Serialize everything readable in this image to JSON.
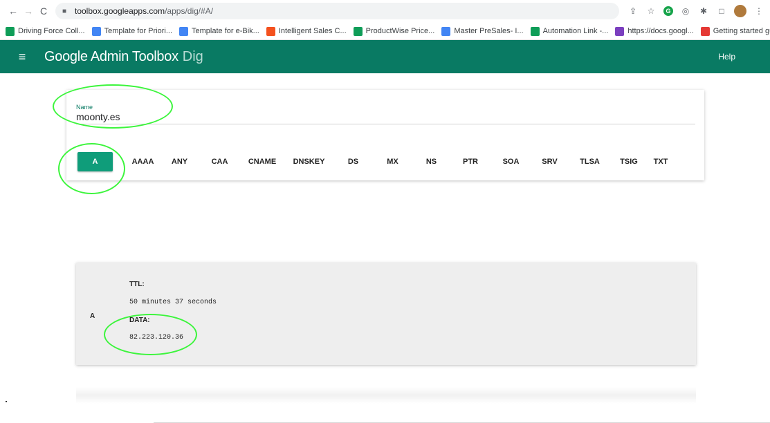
{
  "browser": {
    "url_host": "toolbox.googleapps.com",
    "url_path": "/apps/dig/#A/",
    "bookmarks": [
      {
        "label": "Driving Force Coll...",
        "color": "#0f9d58"
      },
      {
        "label": "Template for Priori...",
        "color": "#4285f4"
      },
      {
        "label": "Template for e-Bik...",
        "color": "#4285f4"
      },
      {
        "label": "Intelligent Sales C...",
        "color": "#f4511e"
      },
      {
        "label": "ProductWise Price...",
        "color": "#0f9d58"
      },
      {
        "label": "Master PreSales- I...",
        "color": "#4285f4"
      },
      {
        "label": "Automation Link -...",
        "color": "#0f9d58"
      },
      {
        "label": "https://docs.googl...",
        "color": "#7b3fbf"
      },
      {
        "label": "Getting started gu...",
        "color": "#e53935"
      }
    ],
    "more": "»"
  },
  "app": {
    "title": "Google Admin Toolbox",
    "subtitle": "Dig",
    "help": "Help",
    "bar_color": "#097a63"
  },
  "query": {
    "name_label": "Name",
    "name_value": "moonty.es"
  },
  "record_types": [
    "A",
    "AAAA",
    "ANY",
    "CAA",
    "CNAME",
    "DNSKEY",
    "DS",
    "MX",
    "NS",
    "PTR",
    "SOA",
    "SRV",
    "TLSA",
    "TSIG",
    "TXT"
  ],
  "selected_type": "A",
  "result": {
    "type": "A",
    "ttl_label": "TTL:",
    "ttl_value": "50 minutes 37 seconds",
    "data_label": "DATA:",
    "data_value": "82.223.120.36"
  }
}
